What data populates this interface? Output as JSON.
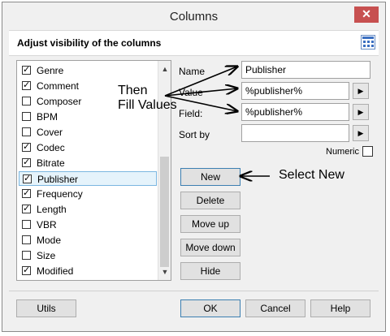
{
  "window": {
    "title": "Columns",
    "close_glyph": "✕"
  },
  "header": {
    "title": "Adjust visibility of the columns",
    "icon": "column-grid-icon"
  },
  "columns_list": {
    "items": [
      {
        "label": "Genre",
        "checked": true
      },
      {
        "label": "Comment",
        "checked": true
      },
      {
        "label": "Composer",
        "checked": false
      },
      {
        "label": "BPM",
        "checked": false
      },
      {
        "label": "Cover",
        "checked": false
      },
      {
        "label": "Codec",
        "checked": true
      },
      {
        "label": "Bitrate",
        "checked": true
      },
      {
        "label": "Publisher",
        "checked": true,
        "selected": true
      },
      {
        "label": "Frequency",
        "checked": true
      },
      {
        "label": "Length",
        "checked": true
      },
      {
        "label": "VBR",
        "checked": false
      },
      {
        "label": "Mode",
        "checked": false
      },
      {
        "label": "Size",
        "checked": false
      },
      {
        "label": "Modified",
        "checked": true
      }
    ]
  },
  "form": {
    "name_label": "Name",
    "name_value": "Publisher",
    "value_label": "Value",
    "value_value": "%publisher%",
    "field_label": "Field:",
    "field_value": "%publisher%",
    "sortby_label": "Sort by",
    "sortby_value": "",
    "numeric_label": "Numeric",
    "numeric_checked": false
  },
  "side_buttons": {
    "new": "New",
    "delete": "Delete",
    "move_up": "Move up",
    "move_down": "Move down",
    "hide": "Hide"
  },
  "footer": {
    "utils": "Utils",
    "ok": "OK",
    "cancel": "Cancel",
    "help": "Help"
  },
  "annotations": {
    "then": "Then",
    "fill_values": "Fill Values",
    "select_new": "Select New"
  },
  "colors": {
    "close_button": "#c75050",
    "selection": "#e5f3fb",
    "accent_border": "#3c7fb1"
  }
}
